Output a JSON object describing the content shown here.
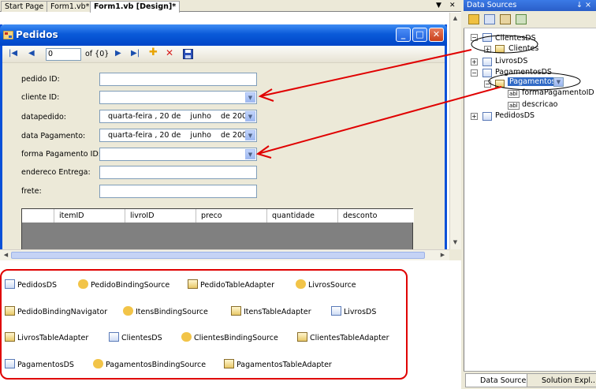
{
  "doc_tabs": [
    "Start Page",
    "Form1.vb*",
    "Form1.vb [Design]*"
  ],
  "form": {
    "title": "Pedidos",
    "nav": {
      "position": "0",
      "of": "of {0}"
    },
    "fields": [
      {
        "label": "pedido ID:",
        "kind": "text",
        "value": ""
      },
      {
        "label": "cliente ID:",
        "kind": "combo",
        "value": ""
      },
      {
        "label": "datapedido:",
        "kind": "date",
        "value": "quarta-feira , 20 de    junho    de 2007"
      },
      {
        "label": "data Pagamento:",
        "kind": "date",
        "value": "quarta-feira , 20 de    junho    de 2007"
      },
      {
        "label": "forma Pagamento ID:",
        "kind": "combo",
        "value": ""
      },
      {
        "label": "endereco Entrega:",
        "kind": "text",
        "value": ""
      },
      {
        "label": "frete:",
        "kind": "text",
        "value": ""
      }
    ],
    "grid_columns": [
      "itemID",
      "livroID",
      "preco",
      "quantidade",
      "desconto"
    ]
  },
  "tray": [
    [
      "PedidosDS",
      "PedidoBindingSource",
      "PedidoTableAdapter",
      "LivrosSource"
    ],
    [
      "PedidoBindingNavigator",
      "ItensBindingSource",
      "ItensTableAdapter",
      "LivrosDS"
    ],
    [
      "LivrosTableAdapter",
      "ClientesDS",
      "ClientesBindingSource",
      "ClientesTableAdapter"
    ],
    [
      "PagamentosDS",
      "PagamentosBindingSource",
      "PagamentosTableAdapter"
    ]
  ],
  "data_sources": {
    "title": "Data Sources",
    "pin": "↓ ×",
    "tree": [
      "ClientesDS",
      "Clientes",
      "LivrosDS",
      "PagamentosDS",
      "Pagamentos",
      "formaPagamentoID",
      "descricao",
      "PedidosDS"
    ],
    "abl": "abl"
  },
  "bottom_tabs": [
    "Data Sources",
    "Solution Expl..."
  ],
  "colors": {
    "annotation": "#e00000",
    "title_blue": "#0a5ad9"
  }
}
